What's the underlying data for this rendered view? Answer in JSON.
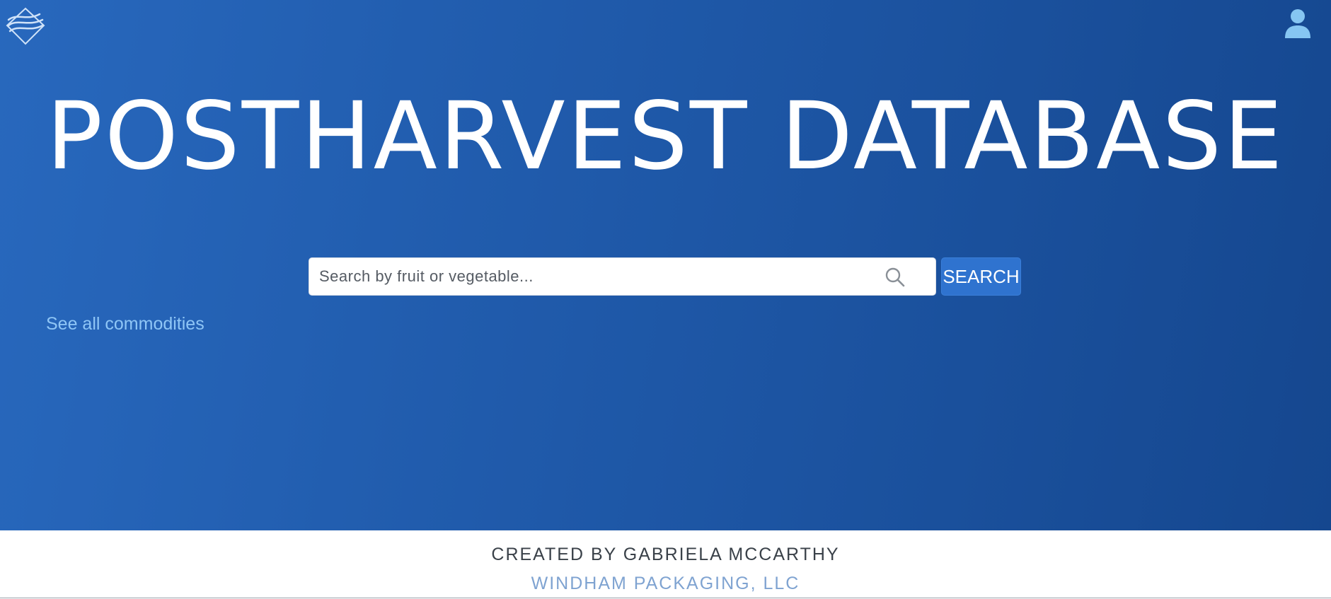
{
  "header": {
    "logo_icon": "wave-diamond-logo-icon",
    "user_icon": "user-icon"
  },
  "hero": {
    "title": "POSTHARVEST DATABASE"
  },
  "search": {
    "placeholder": "Search by fruit or vegetable...",
    "value": "",
    "icon": "magnifier-icon",
    "button_label": "SEARCH"
  },
  "links": {
    "see_all": "See all commodities"
  },
  "footer": {
    "credit": "CREATED BY GABRIELA MCCARTHY",
    "company": "WINDHAM PACKAGING, LLC"
  },
  "colors": {
    "hero_gradient_start": "#2868bd",
    "hero_gradient_end": "#15478f",
    "button_bg": "#2f73cf",
    "link": "#8fc6f6",
    "company_link": "#7fa3d1"
  }
}
